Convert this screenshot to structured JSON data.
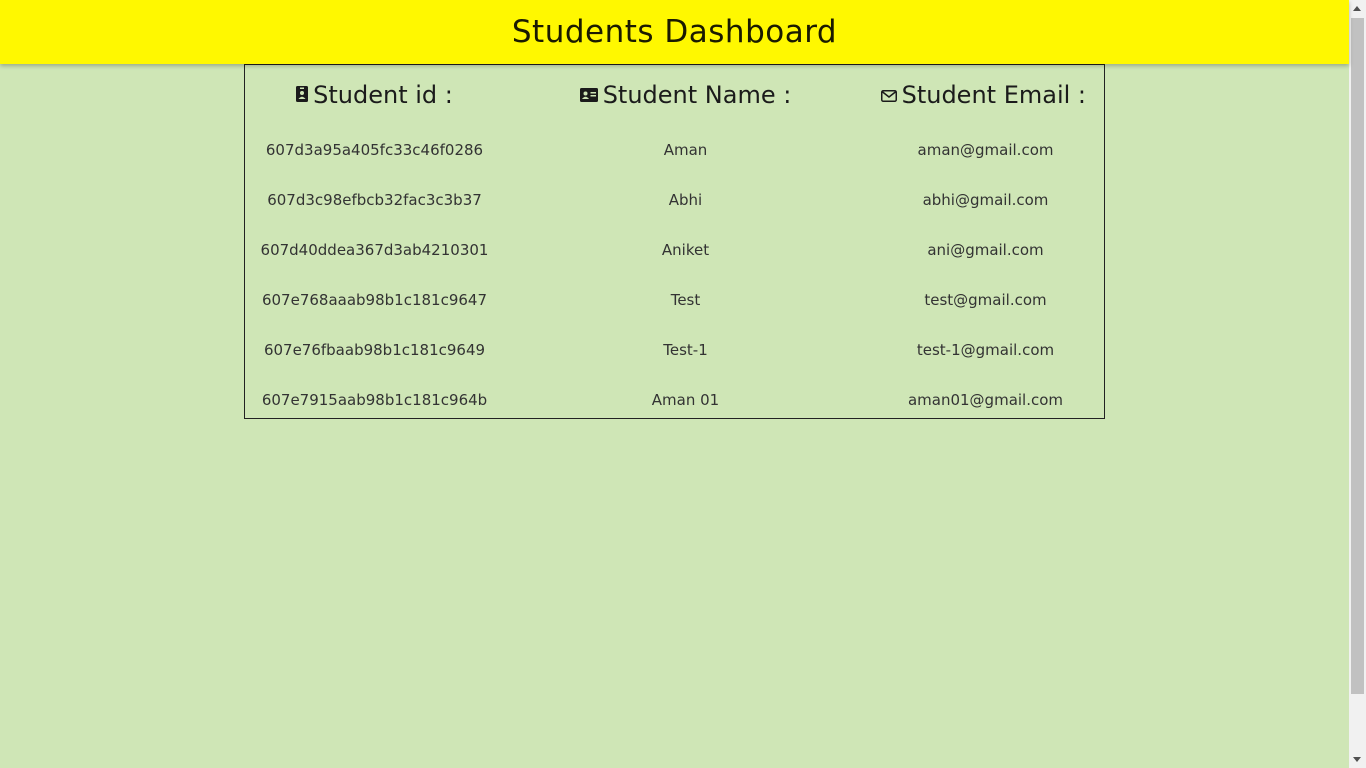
{
  "header": {
    "title": "Students Dashboard"
  },
  "table": {
    "columns": [
      {
        "label": "Student id :",
        "icon": "id-badge-icon"
      },
      {
        "label": "Student Name :",
        "icon": "id-card-icon"
      },
      {
        "label": "Student Email :",
        "icon": "envelope-icon"
      }
    ],
    "rows": [
      {
        "id": "607d3a95a405fc33c46f0286",
        "name": "Aman",
        "email": "aman@gmail.com"
      },
      {
        "id": "607d3c98efbcb32fac3c3b37",
        "name": "Abhi",
        "email": "abhi@gmail.com"
      },
      {
        "id": "607d40ddea367d3ab4210301",
        "name": "Aniket",
        "email": "ani@gmail.com"
      },
      {
        "id": "607e768aaab98b1c181c9647",
        "name": "Test",
        "email": "test@gmail.com"
      },
      {
        "id": "607e76fbaab98b1c181c9649",
        "name": "Test-1",
        "email": "test-1@gmail.com"
      },
      {
        "id": "607e7915aab98b1c181c964b",
        "name": "Aman 01",
        "email": "aman01@gmail.com"
      }
    ]
  },
  "colors": {
    "header_bg": "#fff800",
    "page_bg": "#cfe6b6",
    "border": "#222222"
  }
}
